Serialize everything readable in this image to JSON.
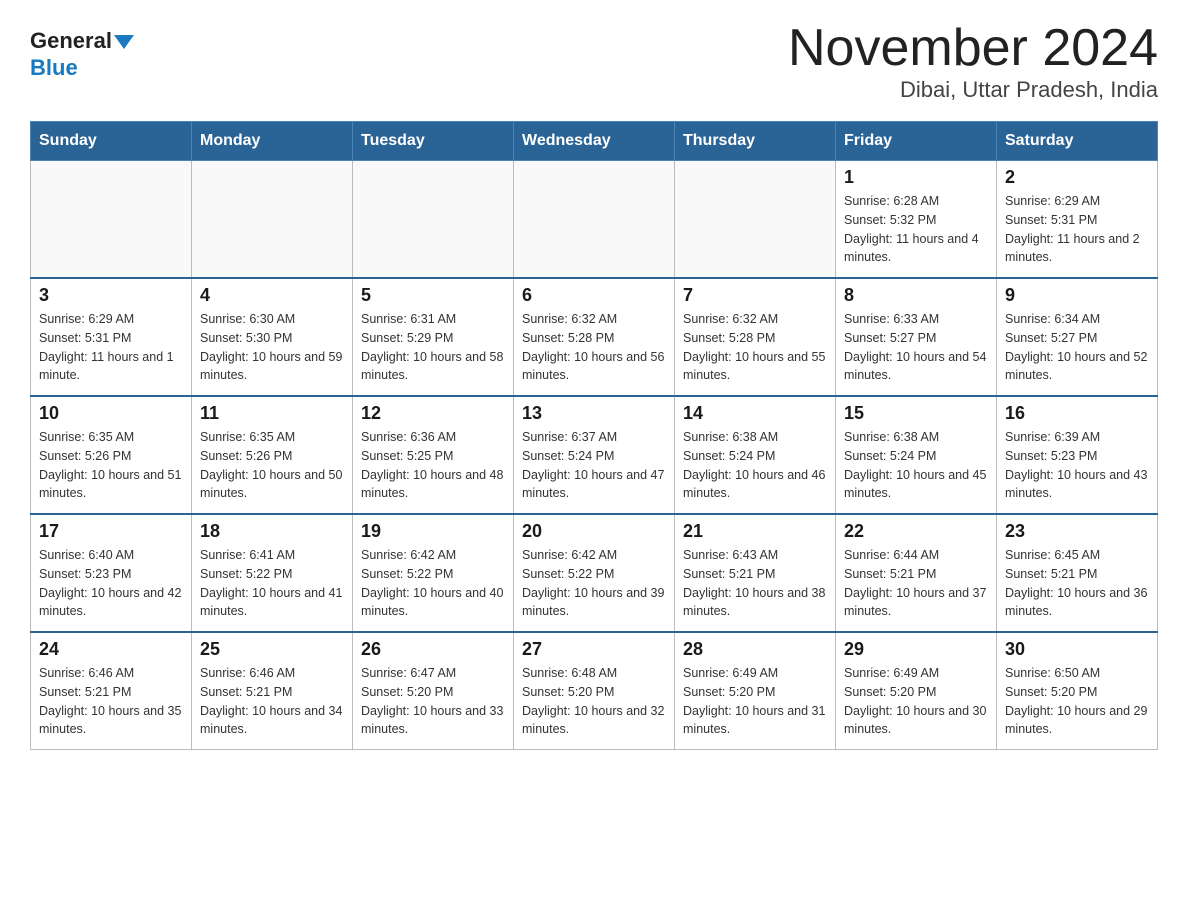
{
  "header": {
    "logo_general": "General",
    "logo_blue": "Blue",
    "title": "November 2024",
    "subtitle": "Dibai, Uttar Pradesh, India"
  },
  "days_of_week": [
    "Sunday",
    "Monday",
    "Tuesday",
    "Wednesday",
    "Thursday",
    "Friday",
    "Saturday"
  ],
  "weeks": [
    [
      {
        "day": "",
        "info": ""
      },
      {
        "day": "",
        "info": ""
      },
      {
        "day": "",
        "info": ""
      },
      {
        "day": "",
        "info": ""
      },
      {
        "day": "",
        "info": ""
      },
      {
        "day": "1",
        "info": "Sunrise: 6:28 AM\nSunset: 5:32 PM\nDaylight: 11 hours and 4 minutes."
      },
      {
        "day": "2",
        "info": "Sunrise: 6:29 AM\nSunset: 5:31 PM\nDaylight: 11 hours and 2 minutes."
      }
    ],
    [
      {
        "day": "3",
        "info": "Sunrise: 6:29 AM\nSunset: 5:31 PM\nDaylight: 11 hours and 1 minute."
      },
      {
        "day": "4",
        "info": "Sunrise: 6:30 AM\nSunset: 5:30 PM\nDaylight: 10 hours and 59 minutes."
      },
      {
        "day": "5",
        "info": "Sunrise: 6:31 AM\nSunset: 5:29 PM\nDaylight: 10 hours and 58 minutes."
      },
      {
        "day": "6",
        "info": "Sunrise: 6:32 AM\nSunset: 5:28 PM\nDaylight: 10 hours and 56 minutes."
      },
      {
        "day": "7",
        "info": "Sunrise: 6:32 AM\nSunset: 5:28 PM\nDaylight: 10 hours and 55 minutes."
      },
      {
        "day": "8",
        "info": "Sunrise: 6:33 AM\nSunset: 5:27 PM\nDaylight: 10 hours and 54 minutes."
      },
      {
        "day": "9",
        "info": "Sunrise: 6:34 AM\nSunset: 5:27 PM\nDaylight: 10 hours and 52 minutes."
      }
    ],
    [
      {
        "day": "10",
        "info": "Sunrise: 6:35 AM\nSunset: 5:26 PM\nDaylight: 10 hours and 51 minutes."
      },
      {
        "day": "11",
        "info": "Sunrise: 6:35 AM\nSunset: 5:26 PM\nDaylight: 10 hours and 50 minutes."
      },
      {
        "day": "12",
        "info": "Sunrise: 6:36 AM\nSunset: 5:25 PM\nDaylight: 10 hours and 48 minutes."
      },
      {
        "day": "13",
        "info": "Sunrise: 6:37 AM\nSunset: 5:24 PM\nDaylight: 10 hours and 47 minutes."
      },
      {
        "day": "14",
        "info": "Sunrise: 6:38 AM\nSunset: 5:24 PM\nDaylight: 10 hours and 46 minutes."
      },
      {
        "day": "15",
        "info": "Sunrise: 6:38 AM\nSunset: 5:24 PM\nDaylight: 10 hours and 45 minutes."
      },
      {
        "day": "16",
        "info": "Sunrise: 6:39 AM\nSunset: 5:23 PM\nDaylight: 10 hours and 43 minutes."
      }
    ],
    [
      {
        "day": "17",
        "info": "Sunrise: 6:40 AM\nSunset: 5:23 PM\nDaylight: 10 hours and 42 minutes."
      },
      {
        "day": "18",
        "info": "Sunrise: 6:41 AM\nSunset: 5:22 PM\nDaylight: 10 hours and 41 minutes."
      },
      {
        "day": "19",
        "info": "Sunrise: 6:42 AM\nSunset: 5:22 PM\nDaylight: 10 hours and 40 minutes."
      },
      {
        "day": "20",
        "info": "Sunrise: 6:42 AM\nSunset: 5:22 PM\nDaylight: 10 hours and 39 minutes."
      },
      {
        "day": "21",
        "info": "Sunrise: 6:43 AM\nSunset: 5:21 PM\nDaylight: 10 hours and 38 minutes."
      },
      {
        "day": "22",
        "info": "Sunrise: 6:44 AM\nSunset: 5:21 PM\nDaylight: 10 hours and 37 minutes."
      },
      {
        "day": "23",
        "info": "Sunrise: 6:45 AM\nSunset: 5:21 PM\nDaylight: 10 hours and 36 minutes."
      }
    ],
    [
      {
        "day": "24",
        "info": "Sunrise: 6:46 AM\nSunset: 5:21 PM\nDaylight: 10 hours and 35 minutes."
      },
      {
        "day": "25",
        "info": "Sunrise: 6:46 AM\nSunset: 5:21 PM\nDaylight: 10 hours and 34 minutes."
      },
      {
        "day": "26",
        "info": "Sunrise: 6:47 AM\nSunset: 5:20 PM\nDaylight: 10 hours and 33 minutes."
      },
      {
        "day": "27",
        "info": "Sunrise: 6:48 AM\nSunset: 5:20 PM\nDaylight: 10 hours and 32 minutes."
      },
      {
        "day": "28",
        "info": "Sunrise: 6:49 AM\nSunset: 5:20 PM\nDaylight: 10 hours and 31 minutes."
      },
      {
        "day": "29",
        "info": "Sunrise: 6:49 AM\nSunset: 5:20 PM\nDaylight: 10 hours and 30 minutes."
      },
      {
        "day": "30",
        "info": "Sunrise: 6:50 AM\nSunset: 5:20 PM\nDaylight: 10 hours and 29 minutes."
      }
    ]
  ]
}
